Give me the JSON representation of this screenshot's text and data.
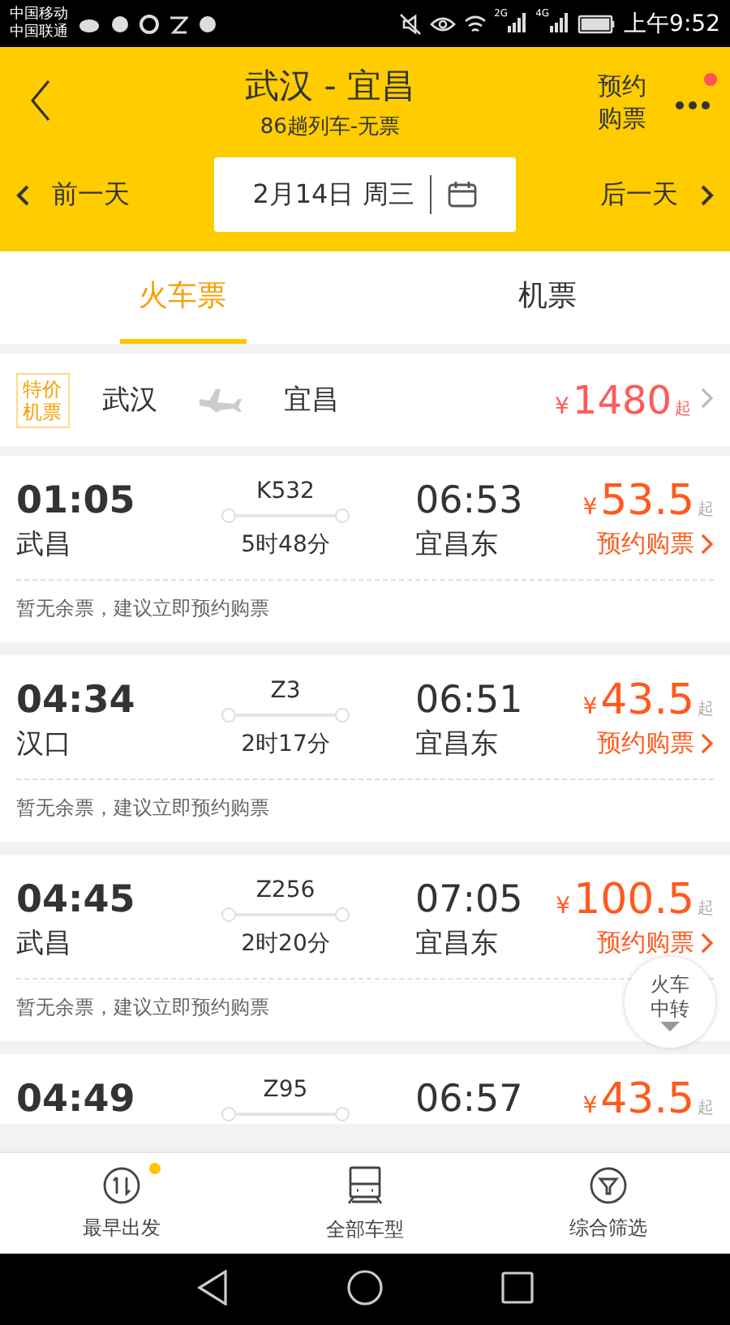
{
  "status_bar": {
    "carriers": [
      "中国移动",
      "中国联通"
    ],
    "network_labels": [
      "2G",
      "4G"
    ],
    "time": "上午9:52"
  },
  "header": {
    "title": "武汉 - 宜昌",
    "subtitle": "86趟列车-无票",
    "reserve": "预约购票",
    "more_badge": true
  },
  "date_bar": {
    "prev": "前一天",
    "date": "2月14日 周三",
    "next": "后一天"
  },
  "tabs": [
    {
      "label": "火车票",
      "selected": true
    },
    {
      "label": "机票",
      "selected": false
    }
  ],
  "flight_promo": {
    "badge": "特价机票",
    "from": "武汉",
    "to": "宜昌",
    "currency": "¥",
    "price": "1480",
    "suffix": "起"
  },
  "trains": [
    {
      "depart": "01:05",
      "train": "K532",
      "arrive": "06:53",
      "currency": "¥",
      "price": "53.5",
      "suffix": "起",
      "from": "武昌",
      "duration": "5时48分",
      "to": "宜昌东",
      "action": "预约购票",
      "note": "暂无余票，建议立即预约购票"
    },
    {
      "depart": "04:34",
      "train": "Z3",
      "arrive": "06:51",
      "currency": "¥",
      "price": "43.5",
      "suffix": "起",
      "from": "汉口",
      "duration": "2时17分",
      "to": "宜昌东",
      "action": "预约购票",
      "note": "暂无余票，建议立即预约购票"
    },
    {
      "depart": "04:45",
      "train": "Z256",
      "arrive": "07:05",
      "currency": "¥",
      "price": "100.5",
      "suffix": "起",
      "from": "武昌",
      "duration": "2时20分",
      "to": "宜昌东",
      "action": "预约购票",
      "note": "暂无余票，建议立即预约购票"
    },
    {
      "depart": "04:49",
      "train": "Z95",
      "arrive": "06:57",
      "currency": "¥",
      "price": "43.5",
      "suffix": "起"
    }
  ],
  "transfer_button": {
    "label": "火车中转"
  },
  "bottom_nav": [
    {
      "kind": "sort",
      "label": "最早出发",
      "badge": true
    },
    {
      "kind": "train",
      "label": "全部车型",
      "badge": false
    },
    {
      "kind": "filter",
      "label": "综合筛选",
      "badge": false
    }
  ]
}
